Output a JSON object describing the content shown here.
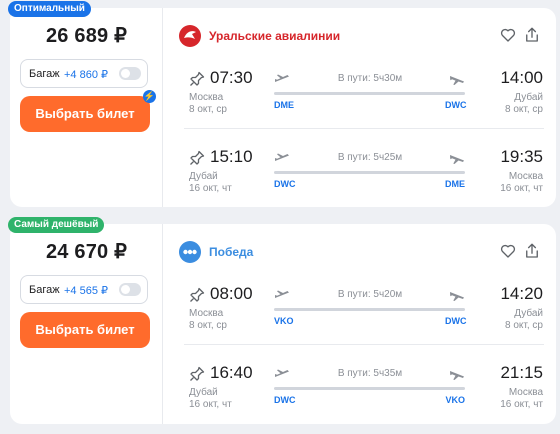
{
  "colors": {
    "accent": "#1a73e8",
    "button": "#ff6b2c",
    "badge_optimal": "#1a73e8",
    "badge_cheapest": "#2fb36b",
    "ural": "#d6262b",
    "pobeda": "#3b8de0"
  },
  "offers": [
    {
      "badge": "Оптимальный",
      "price": "26 689 ₽",
      "baggage_label": "Багаж",
      "baggage_price": "+4 860 ₽",
      "buy_label": "Выбрать билет",
      "airline": "Уральские авиалинии",
      "legs": [
        {
          "dep_time": "07:30",
          "dep_city": "Москва",
          "dep_date": "8 окт, ср",
          "duration": "В пути: 5ч30м",
          "arr_time": "14:00",
          "arr_city": "Дубай",
          "arr_date": "8 окт, ср",
          "from": "DME",
          "to": "DWC"
        },
        {
          "dep_time": "15:10",
          "dep_city": "Дубай",
          "dep_date": "16 окт, чт",
          "duration": "В пути: 5ч25м",
          "arr_time": "19:35",
          "arr_city": "Москва",
          "arr_date": "16 окт, чт",
          "from": "DWC",
          "to": "DME"
        }
      ]
    },
    {
      "badge": "Самый дешёвый",
      "price": "24 670 ₽",
      "baggage_label": "Багаж",
      "baggage_price": "+4 565 ₽",
      "buy_label": "Выбрать билет",
      "airline": "Победа",
      "legs": [
        {
          "dep_time": "08:00",
          "dep_city": "Москва",
          "dep_date": "8 окт, ср",
          "duration": "В пути: 5ч20м",
          "arr_time": "14:20",
          "arr_city": "Дубай",
          "arr_date": "8 окт, ср",
          "from": "VKO",
          "to": "DWC"
        },
        {
          "dep_time": "16:40",
          "dep_city": "Дубай",
          "dep_date": "16 окт, чт",
          "duration": "В пути: 5ч35м",
          "arr_time": "21:15",
          "arr_city": "Москва",
          "arr_date": "16 окт, чт",
          "from": "DWC",
          "to": "VKO"
        }
      ]
    }
  ]
}
